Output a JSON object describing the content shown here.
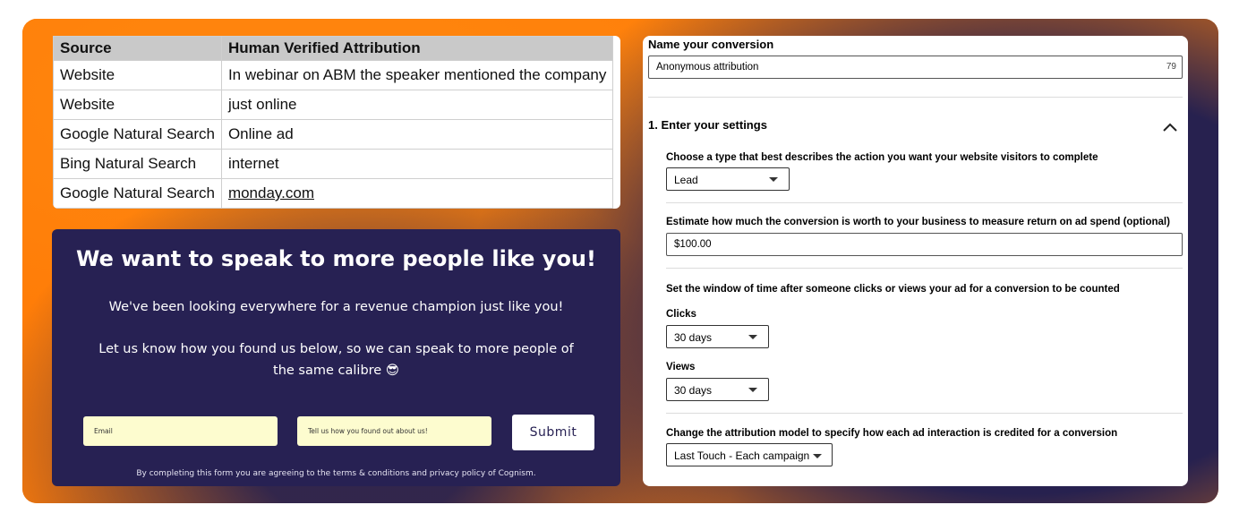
{
  "table": {
    "headers": [
      "Source",
      "Human Verified Attribution"
    ],
    "rows": [
      [
        "Website",
        "In  webinar on ABM the speaker mentioned the company"
      ],
      [
        "Website",
        "just online"
      ],
      [
        "Google Natural Search",
        "Online ad"
      ],
      [
        "Bing Natural Search",
        "internet"
      ],
      [
        "Google Natural Search",
        "monday.com"
      ]
    ]
  },
  "form": {
    "heading": "We want to speak to more people like you!",
    "paragraph1": "We've been looking everywhere for a revenue champion just like you!",
    "paragraph2": "Let us know how you found us below, so we can speak to more people of the same calibre 😎",
    "email_placeholder": "Email",
    "how_placeholder": "Tell us how you found out about us!",
    "submit_label": "Submit",
    "disclaimer": "By completing this form you are agreeing to the terms & conditions and privacy policy of Cognism."
  },
  "settings": {
    "name_label": "Name your conversion",
    "name_value": "Anonymous attribution",
    "name_char_count": "79",
    "section_title": "1. Enter your settings",
    "type_label": "Choose a type that best describes the action you want your website visitors to complete",
    "type_value": "Lead",
    "value_label": "Estimate how much the conversion is worth to your business to measure return on ad spend (optional)",
    "value_amount": "$100.00",
    "window_label": "Set the window of time after someone clicks or views your ad for a conversion to be counted",
    "clicks_label": "Clicks",
    "clicks_value": "30 days",
    "views_label": "Views",
    "views_value": "30 days",
    "model_label": "Change the attribution model to specify how each ad interaction is credited for a conversion",
    "model_value": "Last Touch - Each campaign"
  },
  "colors": {
    "orange": "#ff7f0a",
    "navy": "#27214f",
    "input_yellow": "#fdfccf"
  }
}
